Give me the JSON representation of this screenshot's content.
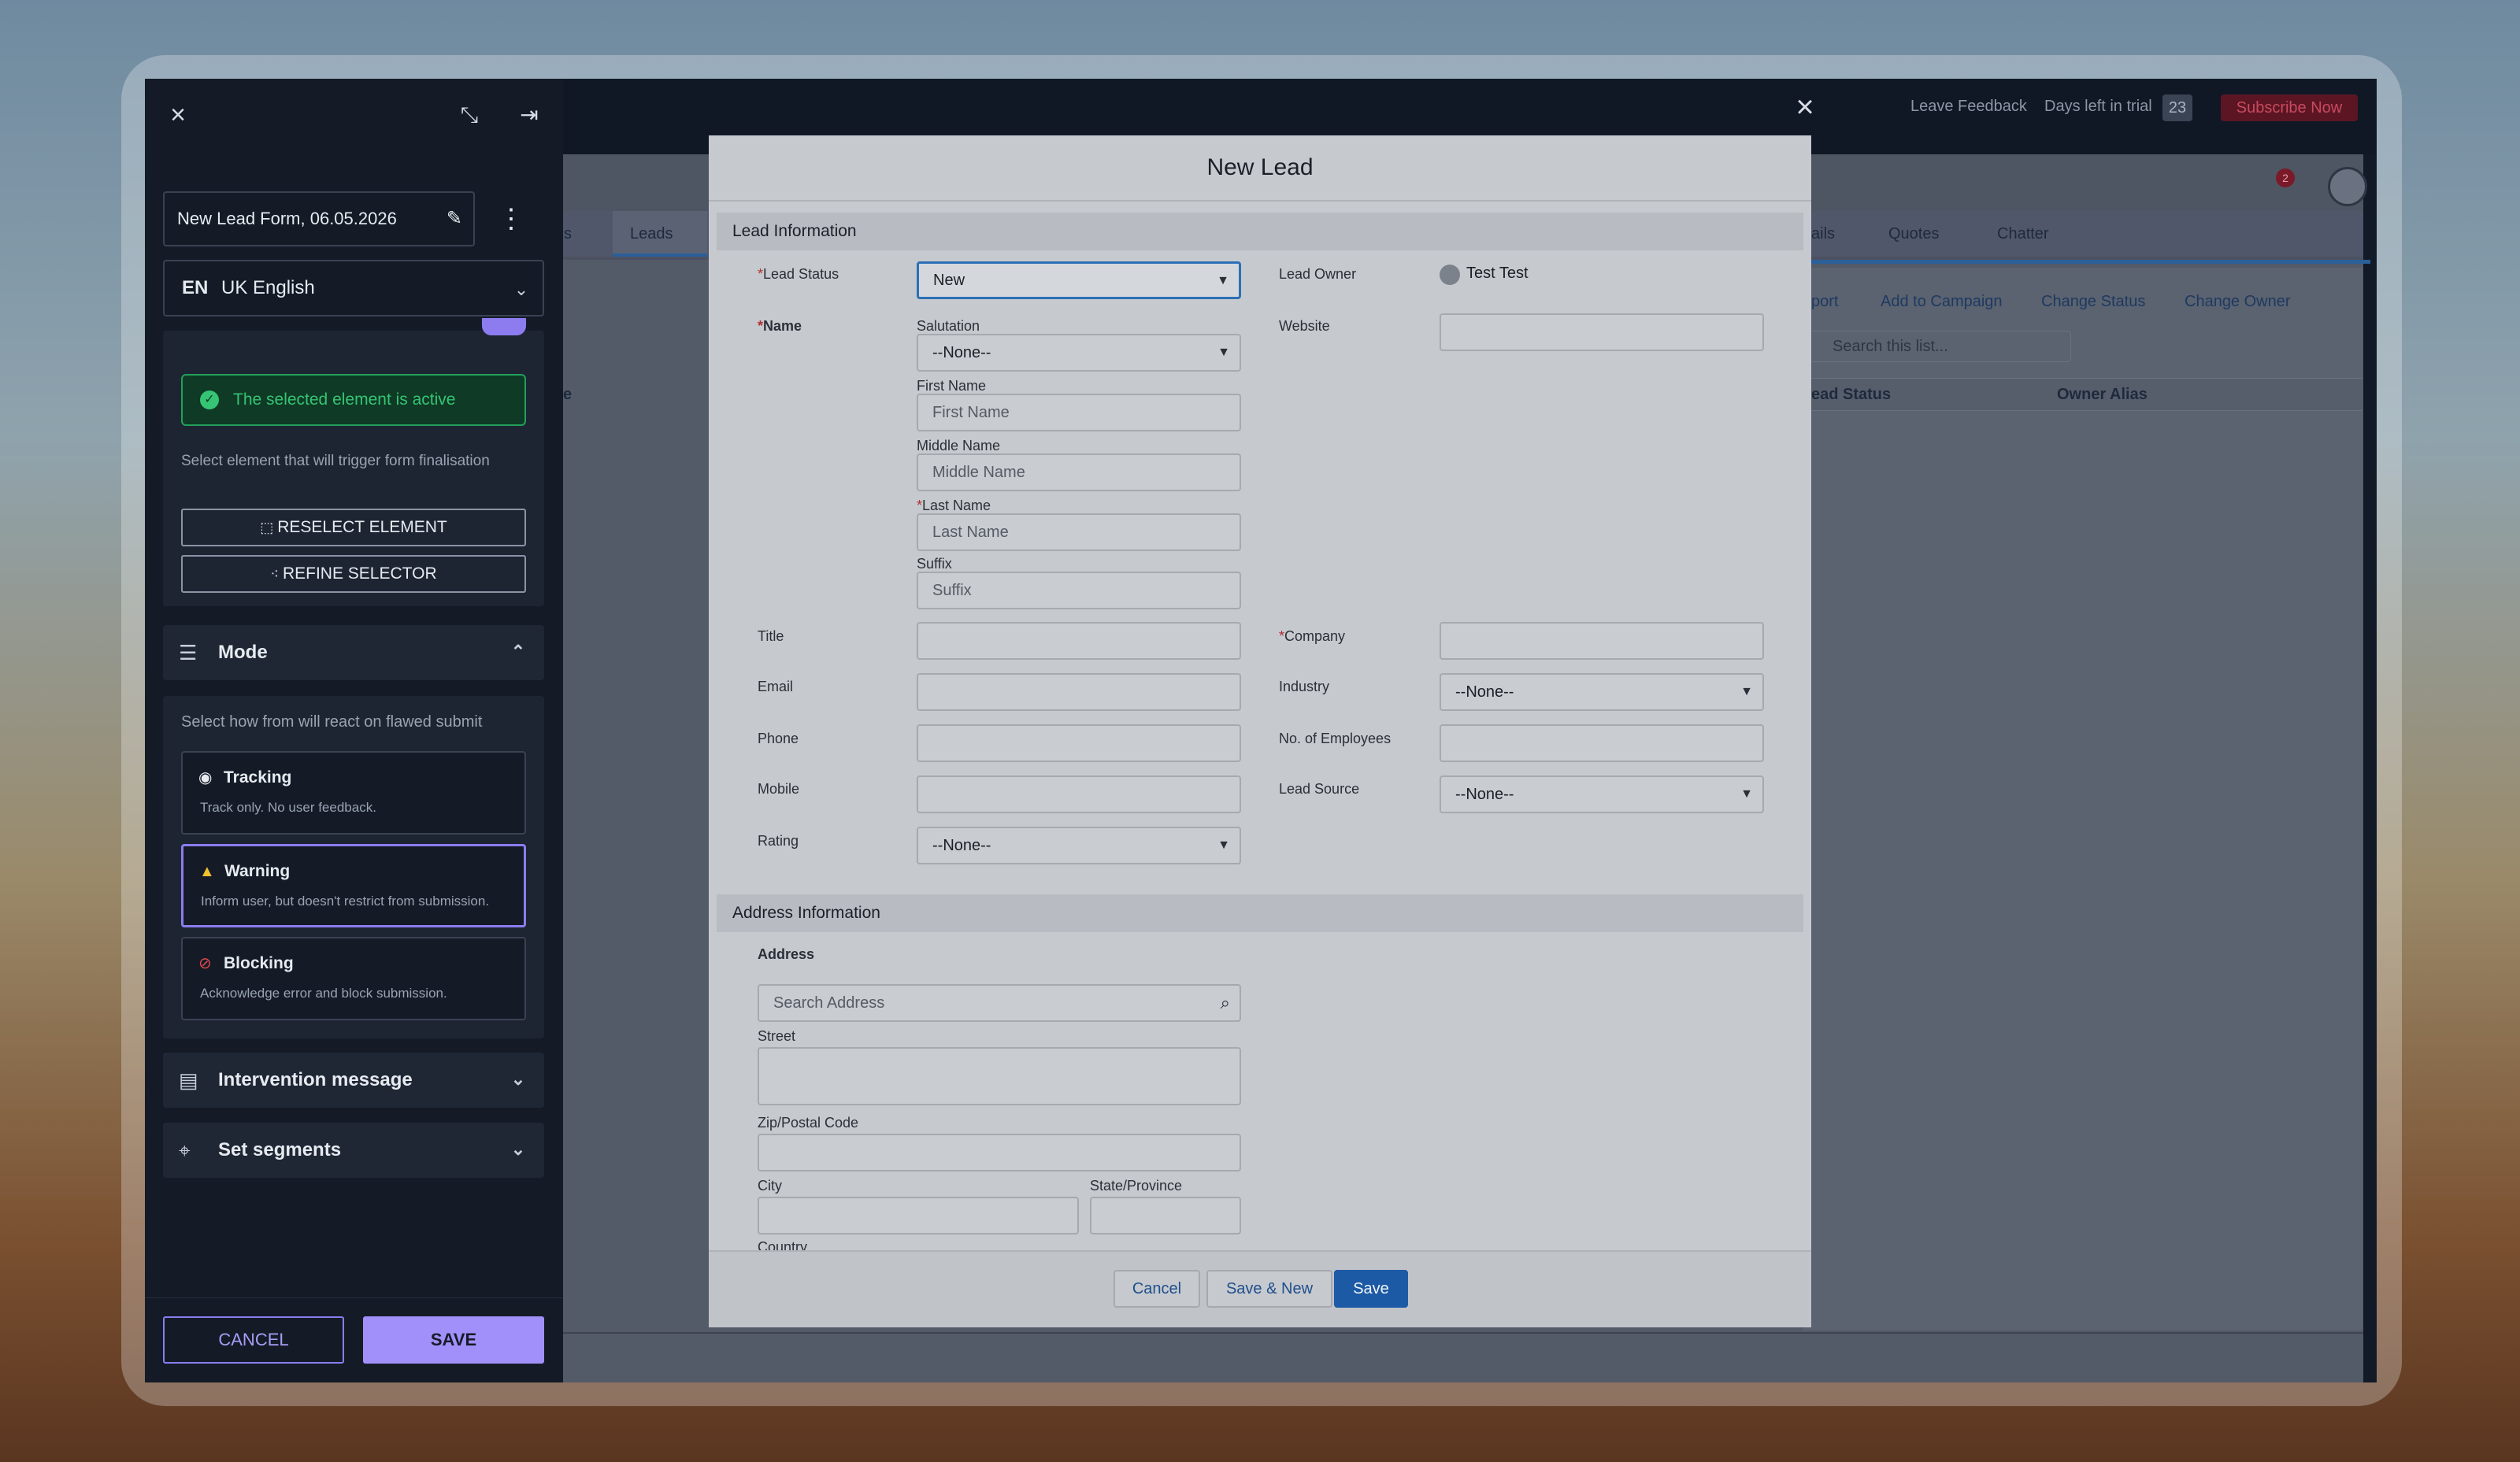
{
  "app": {
    "close_icon": "close-icon",
    "leave_feedback": "Leave Feedback",
    "days_left_label": "Days left in trial",
    "days_left_value": "23",
    "subscribe": "Subscribe Now"
  },
  "background": {
    "nav_tabs": [
      "s",
      "Leads",
      "ails",
      "Quotes",
      "Chatter"
    ],
    "actions": [
      "port",
      "Add to Campaign",
      "Change Status",
      "Change Owner"
    ],
    "search_placeholder": "Search this list...",
    "columns": [
      "ead Status",
      "Owner Alias"
    ],
    "column_stub": "e",
    "notification_count": "2"
  },
  "sidebar": {
    "form_name": "New Lead Form, 06.05.2026",
    "language_code": "EN",
    "language_name": "UK English",
    "active_message": "The selected element is active",
    "hint": "Select  element that will trigger form finalisation",
    "reselect": "RESELECT ELEMENT",
    "refine": "REFINE SELECTOR",
    "mode_title": "Mode",
    "mode_hint": "Select how from will react on flawed submit",
    "modes": [
      {
        "title": "Tracking",
        "desc": "Track only. No user feedback."
      },
      {
        "title": "Warning",
        "desc": "Inform user, but doesn't restrict from submission."
      },
      {
        "title": "Blocking",
        "desc": "Acknowledge error and block submission."
      }
    ],
    "selected_mode": "Warning",
    "intervention": "Intervention message",
    "segments": "Set segments",
    "cancel": "CANCEL",
    "save": "SAVE",
    "accent_color": "#a290fa",
    "success_color": "#35c474"
  },
  "modal": {
    "title": "New Lead",
    "lead_info": "Lead Information",
    "lead_status_label": "Lead Status",
    "lead_status_value": "New",
    "lead_owner_label": "Lead Owner",
    "lead_owner_value": "Test Test",
    "name_label": "Name",
    "salutation_label": "Salutation",
    "salutation_value": "--None--",
    "website_label": "Website",
    "first_name_label": "First Name",
    "first_name_ph": "First Name",
    "middle_name_label": "Middle Name",
    "middle_name_ph": "Middle Name",
    "last_name_label": "Last Name",
    "last_name_ph": "Last Name",
    "suffix_label": "Suffix",
    "suffix_ph": "Suffix",
    "title_label": "Title",
    "company_label": "Company",
    "email_label": "Email",
    "industry_label": "Industry",
    "industry_value": "--None--",
    "phone_label": "Phone",
    "employees_label": "No. of Employees",
    "mobile_label": "Mobile",
    "lead_source_label": "Lead Source",
    "lead_source_value": "--None--",
    "rating_label": "Rating",
    "rating_value": "--None--",
    "address_info": "Address Information",
    "address_label": "Address",
    "search_address_ph": "Search Address",
    "street_label": "Street",
    "zip_label": "Zip/Postal Code",
    "city_label": "City",
    "state_label": "State/Province",
    "country_label": "Country",
    "cancel": "Cancel",
    "save_new": "Save & New",
    "save": "Save"
  }
}
